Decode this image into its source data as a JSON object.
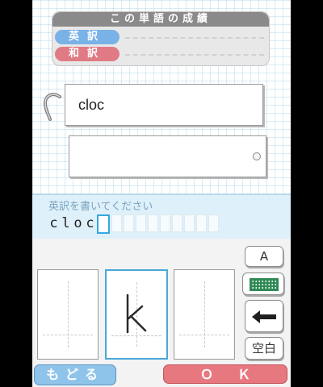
{
  "top_screen": {
    "stats_panel": {
      "title": "この単語の成績",
      "english_translation_label": "英訳",
      "japanese_translation_label": "和訳"
    },
    "word_card_front": "cloc",
    "word_card_back": ""
  },
  "bottom_screen": {
    "prompt": "英訳を書いてください",
    "answer_letters": [
      "c",
      "l",
      "o",
      "c"
    ],
    "handwriting_letter": "k",
    "side_buttons": {
      "letter_mode": "A",
      "space": "空白"
    },
    "back_button": "もどる",
    "ok_button": "ＯＫ"
  },
  "icons": [
    "binder-ring-icon",
    "keyboard-icon",
    "backspace-arrow-icon"
  ],
  "colors": {
    "english_pill": "#79b2e6",
    "japanese_pill": "#e07b86",
    "cursor": "#35a7e0",
    "back_button": "#8ec3ea",
    "ok_button": "#e8787f"
  }
}
